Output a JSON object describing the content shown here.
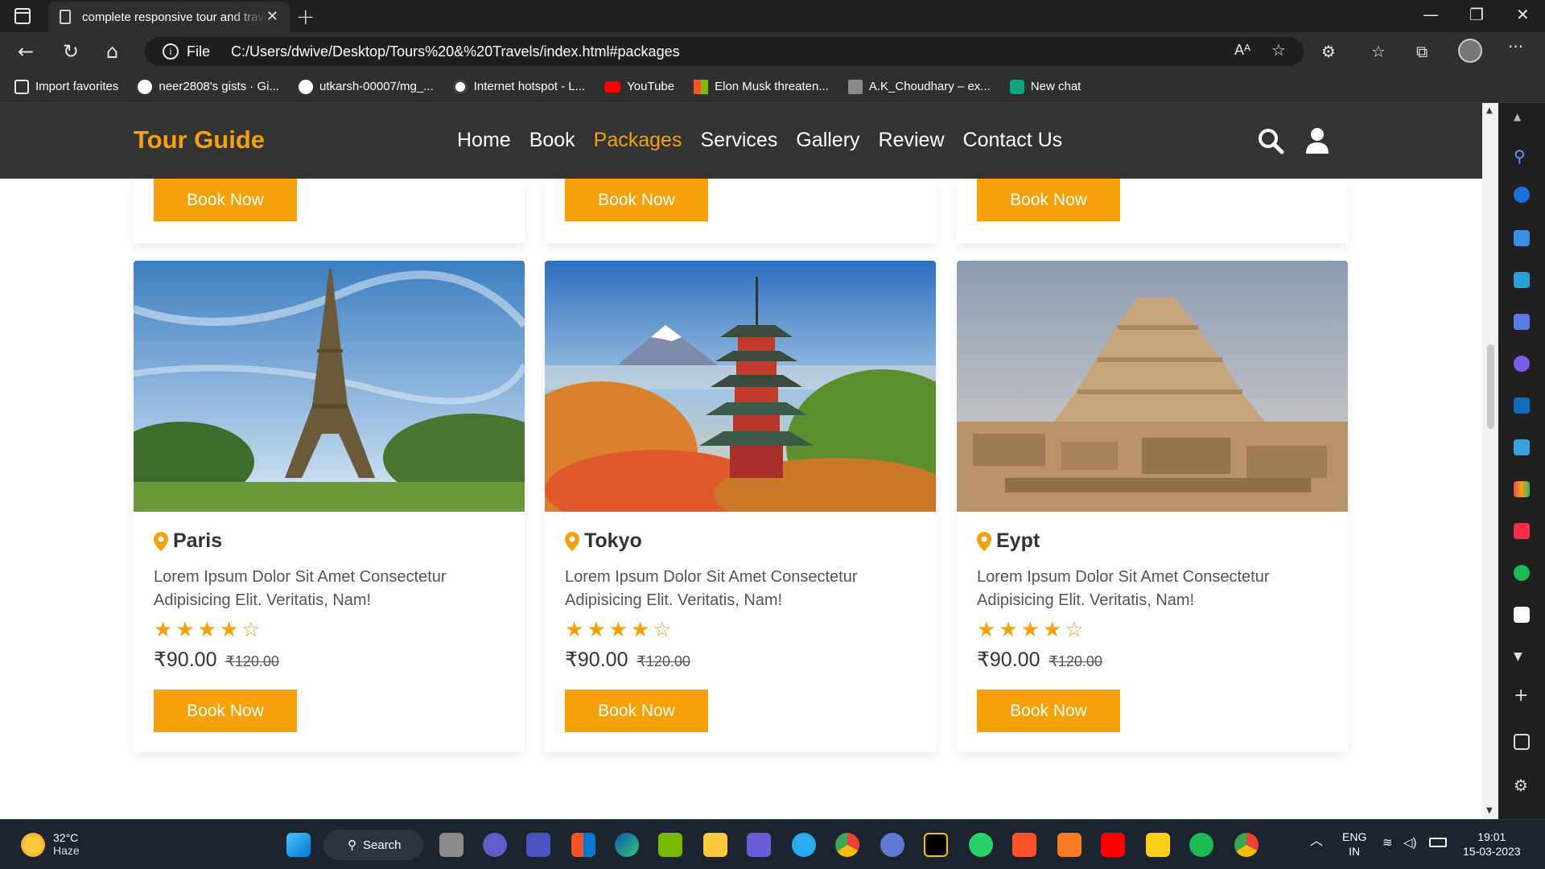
{
  "browser": {
    "tab_title": "complete responsive tour and travel website",
    "url_scheme": "File",
    "url": "C:/Users/dwive/Desktop/Tours%20&%20Travels/index.html#packages",
    "favorites": [
      {
        "label": "Import favorites",
        "icon": "import-icon",
        "color": "#e6e6e6"
      },
      {
        "label": "neer2808's gists · Gi...",
        "icon": "github-icon",
        "color": "#ffffff"
      },
      {
        "label": "utkarsh-00007/mg_...",
        "icon": "github-icon",
        "color": "#ffffff"
      },
      {
        "label": "Internet hotspot - L...",
        "icon": "lifewire-icon",
        "color": "#ffffff"
      },
      {
        "label": "YouTube",
        "icon": "youtube-icon",
        "color": "#ff0000"
      },
      {
        "label": "Elon Musk threaten...",
        "icon": "microsoft-icon",
        "color": "#f35325"
      },
      {
        "label": "A.K_Choudhary – ex...",
        "icon": "image-icon",
        "color": "#8a8a8a"
      },
      {
        "label": "New chat",
        "icon": "chatgpt-icon",
        "color": "#10a37f"
      }
    ]
  },
  "site": {
    "logo": "Tour Guide",
    "nav": [
      "Home",
      "Book",
      "Packages",
      "Services",
      "Gallery",
      "Review",
      "Contact Us"
    ],
    "active_nav": "Packages",
    "accent_color": "#f7a10a",
    "header_bg": "#333333"
  },
  "top_buttons": [
    "Book Now",
    "Book Now",
    "Book Now"
  ],
  "packages": [
    {
      "place": "Paris",
      "description": "Lorem Ipsum Dolor Sit Amet Consectetur Adipisicing Elit. Veritatis, Nam!",
      "rating": 4,
      "max_rating": 5,
      "price": "₹90.00",
      "old_price": "₹120.00",
      "button": "Book Now",
      "image": "eiffel-tower-photo"
    },
    {
      "place": "Tokyo",
      "description": "Lorem Ipsum Dolor Sit Amet Consectetur Adipisicing Elit. Veritatis, Nam!",
      "rating": 4,
      "max_rating": 5,
      "price": "₹90.00",
      "old_price": "₹120.00",
      "button": "Book Now",
      "image": "pagoda-mount-fuji-photo"
    },
    {
      "place": "Eypt",
      "description": "Lorem Ipsum Dolor Sit Amet Consectetur Adipisicing Elit. Veritatis, Nam!",
      "rating": 4,
      "max_rating": 5,
      "price": "₹90.00",
      "old_price": "₹120.00",
      "button": "Book Now",
      "image": "step-pyramid-photo"
    }
  ],
  "taskbar": {
    "weather_temp": "32°C",
    "weather_desc": "Haze",
    "search_label": "Search",
    "lang_top": "ENG",
    "lang_bottom": "IN",
    "time": "19:01",
    "date": "15-03-2023"
  }
}
